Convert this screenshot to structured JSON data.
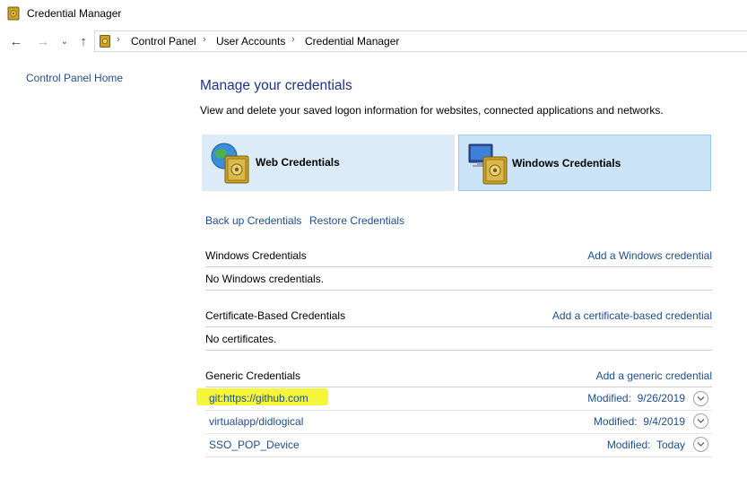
{
  "window": {
    "title": "Credential Manager"
  },
  "nav": {
    "back": "back-arrow",
    "forward": "forward-arrow",
    "recent": "chevron-down",
    "up": "up-arrow"
  },
  "breadcrumb": [
    "Control Panel",
    "User Accounts",
    "Credential Manager"
  ],
  "sidebar": {
    "home_link": "Control Panel Home"
  },
  "main": {
    "title": "Manage your credentials",
    "description": "View and delete your saved logon information for websites, connected applications and networks."
  },
  "tiles": {
    "web": "Web Credentials",
    "windows": "Windows Credentials"
  },
  "backup": {
    "backup_link": "Back up Credentials",
    "restore_link": "Restore Credentials"
  },
  "sections": {
    "windows": {
      "heading": "Windows Credentials",
      "add_link": "Add a Windows credential",
      "empty_text": "No Windows credentials."
    },
    "certificate": {
      "heading": "Certificate-Based Credentials",
      "add_link": "Add a certificate-based credential",
      "empty_text": "No certificates."
    },
    "generic": {
      "heading": "Generic Credentials",
      "add_link": "Add a generic credential",
      "items": [
        {
          "name": "git:https://github.com",
          "modified_label": "Modified:",
          "modified": "9/26/2019"
        },
        {
          "name": "virtualapp/didlogical",
          "modified_label": "Modified:",
          "modified": "9/4/2019"
        },
        {
          "name": "SSO_POP_Device",
          "modified_label": "Modified:",
          "modified": "Today"
        }
      ]
    }
  },
  "colors": {
    "link": "#1e4e8c",
    "title": "#1e3287",
    "highlight": "#f5f53a",
    "tile_selected": "#cce4f7"
  }
}
